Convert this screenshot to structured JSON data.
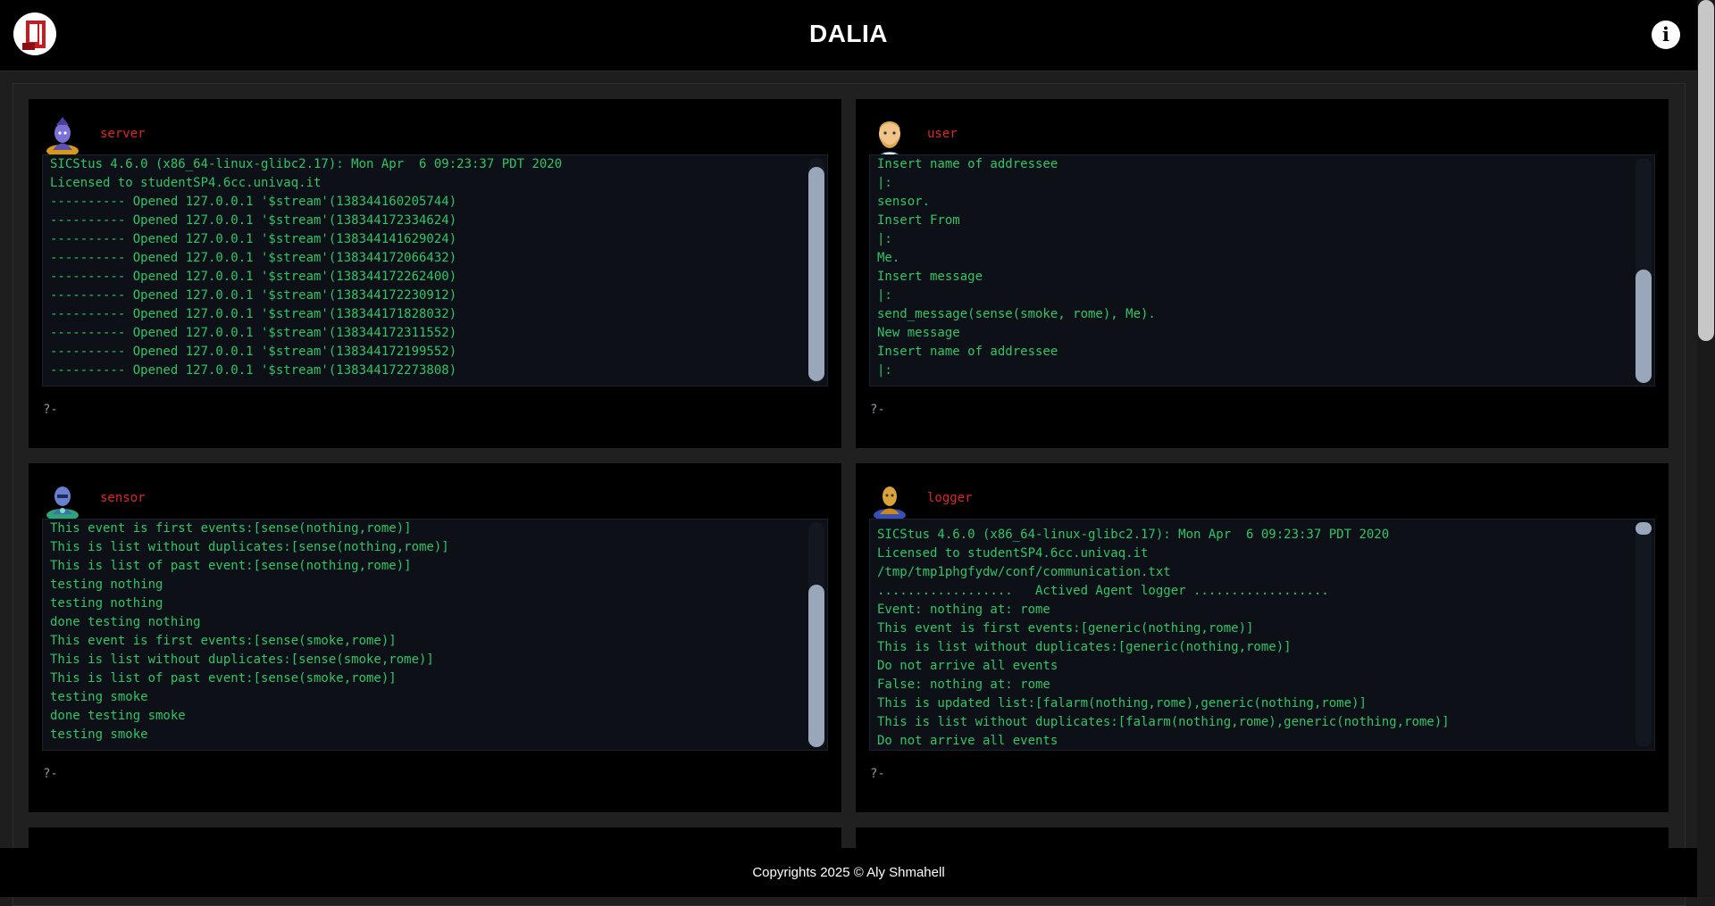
{
  "app": {
    "title": "DALIA",
    "info_icon": "info-icon",
    "logo_icon": "dalia-logo-icon",
    "footer": "Copyrights 2025 © Aly Shmahell"
  },
  "colors": {
    "agent_name": "#e0242a",
    "terminal_text": "#2fc468",
    "terminal_bg": "#0d1117",
    "prompt": "#8a96a6"
  },
  "agents": [
    {
      "name": "server",
      "avatar": "wizard-avatar-icon",
      "prompt": "?-",
      "lines": [
        "SICStus 4.6.0 (x86_64-linux-glibc2.17): Mon Apr  6 09:23:37 PDT 2020",
        "Licensed to studentSP4.6cc.univaq.it",
        "---------- Opened 127.0.0.1 '$stream'(138344160205744)",
        "---------- Opened 127.0.0.1 '$stream'(138344172334624)",
        "---------- Opened 127.0.0.1 '$stream'(138344141629024)",
        "---------- Opened 127.0.0.1 '$stream'(138344172066432)",
        "---------- Opened 127.0.0.1 '$stream'(138344172262400)",
        "---------- Opened 127.0.0.1 '$stream'(138344172230912)",
        "---------- Opened 127.0.0.1 '$stream'(138344171828032)",
        "---------- Opened 127.0.0.1 '$stream'(138344172311552)",
        "---------- Opened 127.0.0.1 '$stream'(138344172199552)",
        "---------- Opened 127.0.0.1 '$stream'(138344172273808)"
      ],
      "scroll_position": 0.95
    },
    {
      "name": "user",
      "avatar": "bearded-man-avatar-icon",
      "prompt": "?-",
      "lines": [
        "Insert name of addressee",
        "|:",
        "sensor.",
        "Insert From",
        "|:",
        "Me.",
        "Insert message",
        "|:",
        "send_message(sense(smoke, rome), Me).",
        "New message",
        "Insert name of addressee",
        "|:"
      ],
      "scroll_position": 1.0
    },
    {
      "name": "sensor",
      "avatar": "robot-avatar-icon",
      "prompt": "?-",
      "lines": [
        "This event is first events:[sense(nothing,rome)]",
        "This is list without duplicates:[sense(nothing,rome)]",
        "This is list of past event:[sense(nothing,rome)]",
        "testing nothing",
        "testing nothing",
        "done testing nothing",
        "This event is first events:[sense(smoke,rome)]",
        "This is list without duplicates:[sense(smoke,rome)]",
        "This is list of past event:[sense(smoke,rome)]",
        "testing smoke",
        "done testing smoke",
        "testing smoke"
      ],
      "scroll_position": 1.0
    },
    {
      "name": "logger",
      "avatar": "scribe-avatar-icon",
      "prompt": "?-",
      "lines": [
        "SICStus 4.6.0 (x86_64-linux-glibc2.17): Mon Apr  6 09:23:37 PDT 2020",
        "Licensed to studentSP4.6cc.univaq.it",
        "/tmp/tmp1phgfydw/conf/communication.txt",
        "..................   Actived Agent logger ..................",
        "Event: nothing at: rome",
        "This event is first events:[generic(nothing,rome)]",
        "This is list without duplicates:[generic(nothing,rome)]",
        "Do not arrive all events",
        "False: nothing at: rome",
        "This is updated list:[falarm(nothing,rome),generic(nothing,rome)]",
        "This is list without duplicates:[falarm(nothing,rome),generic(nothing,rome)]",
        "Do not arrive all events"
      ],
      "scroll_position": 0.0
    }
  ]
}
